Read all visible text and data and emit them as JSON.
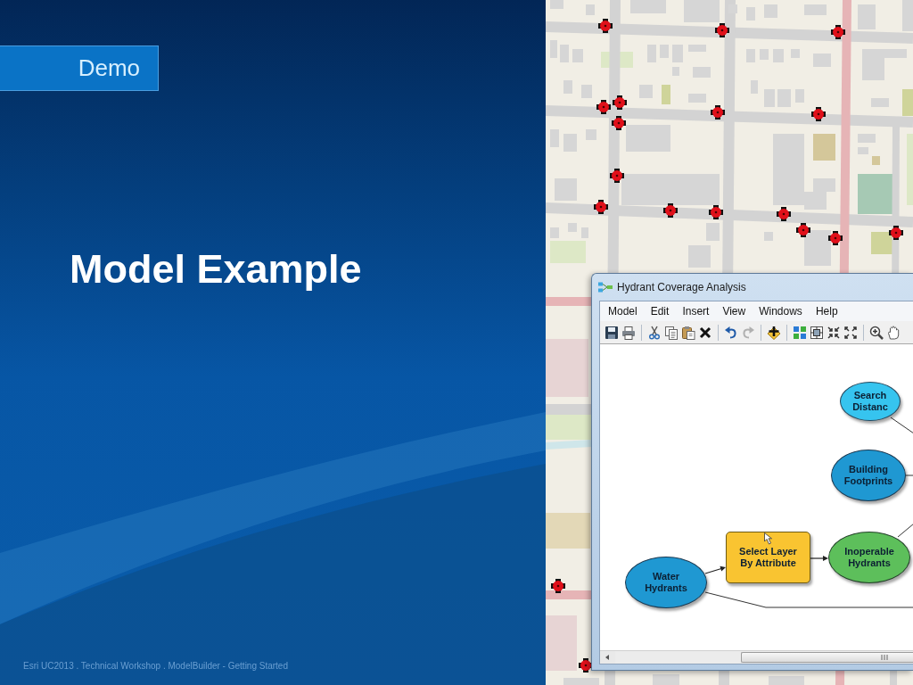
{
  "slide": {
    "badge": "Demo",
    "title": "Model Example",
    "footer": "Esri UC2013 . Technical Workshop . ModelBuilder - Getting Started"
  },
  "window": {
    "title": "Hydrant Coverage Analysis"
  },
  "menu": [
    "Model",
    "Edit",
    "Insert",
    "View",
    "Windows",
    "Help"
  ],
  "toolbar": [
    {
      "disabled": false
    },
    {
      "disabled": false
    },
    {
      "disabled": false
    },
    {
      "disabled": false
    },
    {
      "disabled": false
    },
    {
      "disabled": false
    },
    {
      "disabled": false
    },
    {
      "disabled": true
    },
    {
      "disabled": false
    },
    {
      "disabled": false
    },
    {
      "disabled": false
    },
    {
      "disabled": false
    },
    {
      "disabled": false
    },
    {
      "disabled": false
    },
    {
      "disabled": false
    }
  ],
  "model": {
    "nodes": [
      {
        "kind": "value",
        "label": "Search\nDistanc"
      },
      {
        "kind": "data",
        "label": "Building\nFootprints"
      },
      {
        "kind": "tool",
        "label": "Select Layer\nBy Attribute"
      },
      {
        "kind": "output",
        "label": "Inoperable\nHydrants"
      },
      {
        "kind": "data",
        "label": "Water\nHydrants"
      }
    ]
  }
}
